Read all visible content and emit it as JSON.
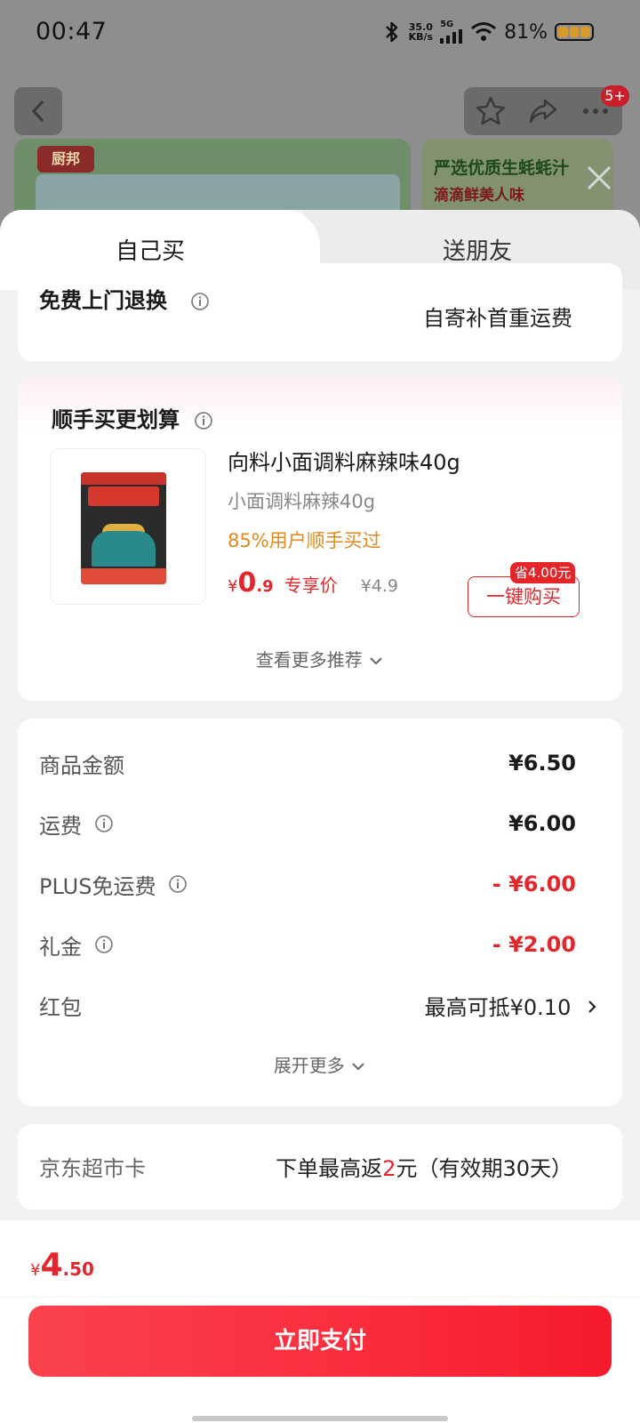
{
  "status_bar": {
    "time": "00:47",
    "net_speed_value": "35.0",
    "net_speed_unit": "KB/s",
    "network": "5G",
    "battery": "81%"
  },
  "header": {
    "cart_badge": "5+"
  },
  "banner": {
    "left_logo": "厨邦",
    "right_line1": "严选优质生蚝蚝汁",
    "right_line2": "滴滴鲜美人味"
  },
  "tabs": [
    {
      "label": "自己买",
      "active": true
    },
    {
      "label": "送朋友",
      "active": false
    }
  ],
  "return_service": {
    "label": "免费上门退换",
    "value": "自寄补首重运费"
  },
  "upsell": {
    "title": "顺手买更划算",
    "product_name": "向料小面调料麻辣味40g",
    "product_sub": "小面调料麻辣40g",
    "social_proof": "85%用户顺手买过",
    "price_symbol": "¥",
    "price_int": "0",
    "price_dec": ".9",
    "price_tag": "专享价",
    "original_price": "¥4.9",
    "save_badge": "省4.00元",
    "buy_button": "一键购买",
    "more": "查看更多推荐"
  },
  "summary": {
    "rows": [
      {
        "label": "商品金额",
        "value": "¥6.50",
        "info": false
      },
      {
        "label": "运费",
        "value": "¥6.00",
        "info": true
      },
      {
        "label": "PLUS免运费",
        "value": "- ¥6.00",
        "info": true
      },
      {
        "label": "礼金",
        "value": "- ¥2.00",
        "info": true
      },
      {
        "label": "红包",
        "value": "最高可抵¥0.10",
        "info": false
      }
    ],
    "expand": "展开更多"
  },
  "jd_card": {
    "label": "京东超市卡",
    "value_prefix": "下单最高返",
    "value_highlight": "2",
    "value_suffix": "元（有效期30天）"
  },
  "footer": {
    "total_symbol": "¥",
    "total_int": "4",
    "total_dec": ".50",
    "pay_button": "立即支付"
  },
  "colors": {
    "accent_red": "#e4262a",
    "social_orange": "#e08a1e"
  }
}
